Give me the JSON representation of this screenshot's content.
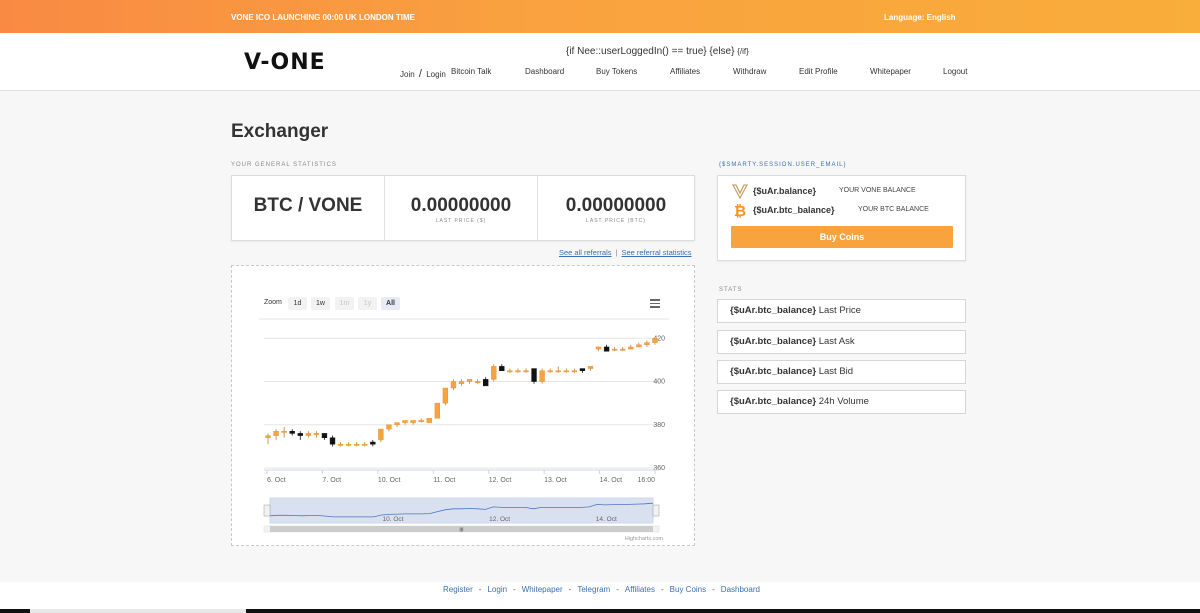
{
  "topbar": {
    "announcement": "VONE ICO LAUNCHING 00:00 UK LONDON TIME",
    "language": "Language: English"
  },
  "header": {
    "logo": "V-ONE",
    "template_code": "{if Nee::userLoggedIn() == true} {else}",
    "template_code_end": "{/if}",
    "auth": {
      "join": "Join",
      "sep": "/",
      "login": "Login"
    },
    "nav": [
      "Bitcoin Talk",
      "Dashboard",
      "Buy Tokens",
      "Affiliates",
      "Withdraw",
      "Edit Profile",
      "Whitepaper",
      "Logout"
    ]
  },
  "page": {
    "title": "Exchanger",
    "general_stats_label": "YOUR GENERAL STATISTICS"
  },
  "stats": {
    "pair": "BTC / VONE",
    "last_price_usd": "0.00000000",
    "last_price_usd_label": "LAST PRICE ($)",
    "last_price_btc": "0.00000000",
    "last_price_btc_label": "LAST PRICE (BTC)"
  },
  "links": {
    "referrals": "See all referrals",
    "sep": "|",
    "referral_stats": "See referral statistics"
  },
  "chart_controls": {
    "zoom_label": "Zoom",
    "buttons": [
      {
        "label": "1d",
        "state": "normal"
      },
      {
        "label": "1w",
        "state": "normal"
      },
      {
        "label": "1m",
        "state": "disabled"
      },
      {
        "label": "1y",
        "state": "disabled"
      },
      {
        "label": "All",
        "state": "active"
      }
    ],
    "credit": "Highcharts.com",
    "navigator_labels": [
      "10. Oct",
      "12. Oct",
      "14. Oct"
    ],
    "scroll_grip": "III"
  },
  "chart_data": {
    "type": "candlestick",
    "x_labels": [
      "6. Oct",
      "7. Oct",
      "10. Oct",
      "11. Oct",
      "12. Oct",
      "13. Oct",
      "14. Oct",
      "16:00"
    ],
    "y_ticks": [
      360,
      380,
      400,
      420
    ],
    "ylim": [
      360,
      428
    ],
    "up_color": "#f7a440",
    "down_color": "#111111",
    "candles": [
      {
        "o": 374,
        "h": 376,
        "l": 371,
        "c": 375
      },
      {
        "o": 375,
        "h": 378,
        "l": 373,
        "c": 377
      },
      {
        "o": 377,
        "h": 379,
        "l": 374,
        "c": 377
      },
      {
        "o": 377,
        "h": 378,
        "l": 375,
        "c": 376
      },
      {
        "o": 376,
        "h": 377,
        "l": 373,
        "c": 375
      },
      {
        "o": 375,
        "h": 377,
        "l": 374,
        "c": 376
      },
      {
        "o": 376,
        "h": 377,
        "l": 374,
        "c": 376
      },
      {
        "o": 376,
        "h": 376,
        "l": 373,
        "c": 374
      },
      {
        "o": 374,
        "h": 375,
        "l": 370,
        "c": 371
      },
      {
        "o": 371,
        "h": 372,
        "l": 370,
        "c": 371
      },
      {
        "o": 371,
        "h": 372,
        "l": 370,
        "c": 371
      },
      {
        "o": 371,
        "h": 372,
        "l": 370,
        "c": 371
      },
      {
        "o": 371,
        "h": 372,
        "l": 370,
        "c": 371
      },
      {
        "o": 372,
        "h": 373,
        "l": 370,
        "c": 371
      },
      {
        "o": 373,
        "h": 378,
        "l": 372,
        "c": 378
      },
      {
        "o": 378,
        "h": 380,
        "l": 377,
        "c": 380
      },
      {
        "o": 380,
        "h": 381,
        "l": 379,
        "c": 381
      },
      {
        "o": 381,
        "h": 382,
        "l": 380,
        "c": 382
      },
      {
        "o": 381,
        "h": 382,
        "l": 380,
        "c": 382
      },
      {
        "o": 382,
        "h": 383,
        "l": 381,
        "c": 382
      },
      {
        "o": 381,
        "h": 383,
        "l": 381,
        "c": 383
      },
      {
        "o": 383,
        "h": 390,
        "l": 383,
        "c": 390
      },
      {
        "o": 390,
        "h": 397,
        "l": 389,
        "c": 397
      },
      {
        "o": 397,
        "h": 401,
        "l": 396,
        "c": 400
      },
      {
        "o": 399,
        "h": 401,
        "l": 398,
        "c": 400
      },
      {
        "o": 400,
        "h": 401,
        "l": 399,
        "c": 401
      },
      {
        "o": 400,
        "h": 401,
        "l": 399,
        "c": 400
      },
      {
        "o": 401,
        "h": 402,
        "l": 398,
        "c": 398
      },
      {
        "o": 401,
        "h": 408,
        "l": 400,
        "c": 407
      },
      {
        "o": 407,
        "h": 408,
        "l": 405,
        "c": 405
      },
      {
        "o": 405,
        "h": 406,
        "l": 404,
        "c": 405
      },
      {
        "o": 405,
        "h": 406,
        "l": 404,
        "c": 405
      },
      {
        "o": 405,
        "h": 406,
        "l": 404,
        "c": 405
      },
      {
        "o": 406,
        "h": 406,
        "l": 399,
        "c": 400
      },
      {
        "o": 400,
        "h": 406,
        "l": 399,
        "c": 405
      },
      {
        "o": 405,
        "h": 406,
        "l": 404,
        "c": 405
      },
      {
        "o": 405,
        "h": 407,
        "l": 404,
        "c": 405
      },
      {
        "o": 405,
        "h": 406,
        "l": 404,
        "c": 405
      },
      {
        "o": 405,
        "h": 406,
        "l": 404,
        "c": 405
      },
      {
        "o": 406,
        "h": 406,
        "l": 404,
        "c": 405
      },
      {
        "o": 406,
        "h": 407,
        "l": 405,
        "c": 407
      },
      {
        "o": 415,
        "h": 416,
        "l": 414,
        "c": 416
      },
      {
        "o": 416,
        "h": 417,
        "l": 414,
        "c": 414
      },
      {
        "o": 415,
        "h": 416,
        "l": 414,
        "c": 415
      },
      {
        "o": 415,
        "h": 416,
        "l": 414,
        "c": 415
      },
      {
        "o": 415,
        "h": 417,
        "l": 415,
        "c": 416
      },
      {
        "o": 416,
        "h": 418,
        "l": 416,
        "c": 417
      },
      {
        "o": 417,
        "h": 419,
        "l": 416,
        "c": 418
      },
      {
        "o": 418,
        "h": 420,
        "l": 417,
        "c": 420
      }
    ]
  },
  "account": {
    "user_email": "{$SMARTY.SESSION.USER_EMAIL}",
    "vone_balance": "{$uAr.balance}",
    "vone_balance_label": "YOUR VONE BALANCE",
    "btc_balance": "{$uAr.btc_balance}",
    "btc_balance_label": "YOUR BTC BALANCE",
    "buy_button": "Buy Coins",
    "vone_icon_color": "#c9a36a",
    "btc_icon_color": "#f7931a"
  },
  "stats_panel": {
    "label": "STATS",
    "items": [
      {
        "var": "{$uAr.btc_balance}",
        "name": "Last Price"
      },
      {
        "var": "{$uAr.btc_balance}",
        "name": "Last Ask"
      },
      {
        "var": "{$uAr.btc_balance}",
        "name": "Last Bid"
      },
      {
        "var": "{$uAr.btc_balance}",
        "name": "24h Volume"
      }
    ]
  },
  "footer": {
    "links": [
      "Register",
      "Login",
      "Whitepaper",
      "Telegram",
      "Affiliates",
      "Buy Coins",
      "Dashboard"
    ],
    "separator": "-"
  },
  "colors": {
    "accent": "#f9a33f",
    "link": "#3a6fb0",
    "topbar_start": "#f98a43",
    "topbar_end": "#f9ad3a"
  }
}
